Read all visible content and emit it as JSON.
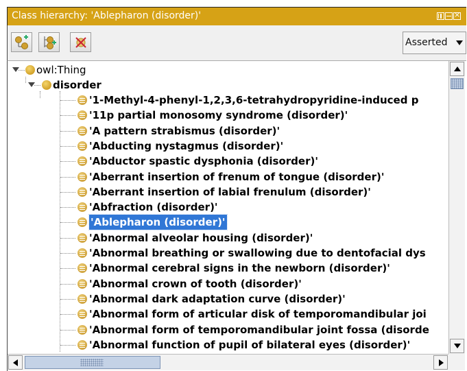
{
  "panel": {
    "title": "Class hierarchy: 'Ablepharon (disorder)'",
    "accent_color": "#d6a216"
  },
  "toolbar": {
    "buttons": [
      {
        "name": "add-subclass-button",
        "icon": "add-subclass-icon"
      },
      {
        "name": "add-sibling-button",
        "icon": "add-sibling-icon"
      },
      {
        "name": "delete-class-button",
        "icon": "delete-class-icon"
      }
    ],
    "view_mode": "Asserted"
  },
  "tree": {
    "root": "owl:Thing",
    "parent": "disorder",
    "selected": "'Ablepharon (disorder)'",
    "items": [
      "'1-Methyl-4-phenyl-1,2,3,6-tetrahydropyridine-induced p",
      "'11p partial monosomy syndrome (disorder)'",
      "'A pattern strabismus (disorder)'",
      "'Abducting nystagmus (disorder)'",
      "'Abductor spastic dysphonia (disorder)'",
      "'Aberrant insertion of frenum of tongue (disorder)'",
      "'Aberrant insertion of labial frenulum (disorder)'",
      "'Abfraction (disorder)'",
      "'Ablepharon (disorder)'",
      "'Abnormal alveolar housing (disorder)'",
      "'Abnormal breathing or swallowing due to dentofacial dys",
      "'Abnormal cerebral signs in the newborn (disorder)'",
      "'Abnormal crown of tooth (disorder)'",
      "'Abnormal dark adaptation curve (disorder)'",
      "'Abnormal form of articular disk of temporomandibular joi",
      "'Abnormal form of temporomandibular joint fossa (disorde",
      "'Abnormal function of pupil of bilateral eyes (disorder)'"
    ]
  }
}
